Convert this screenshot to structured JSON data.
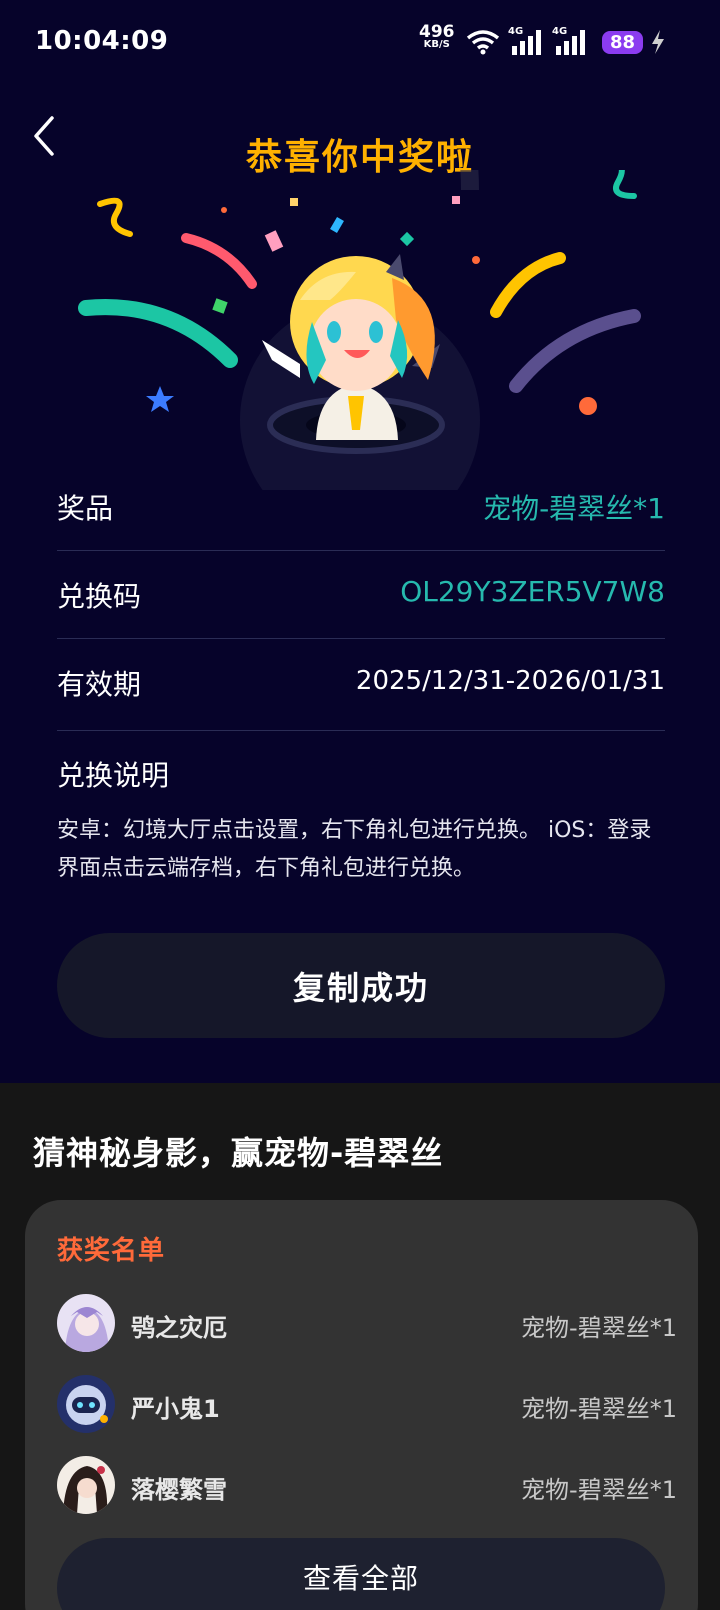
{
  "status": {
    "time": "10:04:09",
    "net_speed": "496",
    "net_unit": "KB/S",
    "net1": "4G",
    "net2": "4G",
    "battery": "88"
  },
  "header": {
    "title": "恭喜你中奖啦"
  },
  "info": {
    "rows": [
      {
        "label": "奖品",
        "value": "宠物-碧翠丝*1"
      },
      {
        "label": "兑换码",
        "value": "OL29Y3ZER5V7W8"
      },
      {
        "label": "有效期",
        "value": "2025/12/31-2026/01/31"
      }
    ],
    "desc_title": "兑换说明",
    "desc_text": "安卓：幻境大厅点击设置，右下角礼包进行兑换。 iOS：登录界面点击云端存档，右下角礼包进行兑换。"
  },
  "copy_button": "复制成功",
  "promo": {
    "title": "猜神秘身影，赢宠物-碧翠丝",
    "winners_title": "获奖名单",
    "winners": [
      {
        "name": "鸮之灾厄",
        "prize": "宠物-碧翠丝*1"
      },
      {
        "name": "严小鬼1",
        "prize": "宠物-碧翠丝*1"
      },
      {
        "name": "落樱繁雪",
        "prize": "宠物-碧翠丝*1"
      }
    ],
    "view_all": "查看全部"
  },
  "colors": {
    "accent_title": "#ffb100",
    "value_teal": "#26b9ae",
    "winners_orange": "#ff6a3a",
    "battery_purple": "#8b3cf0"
  }
}
